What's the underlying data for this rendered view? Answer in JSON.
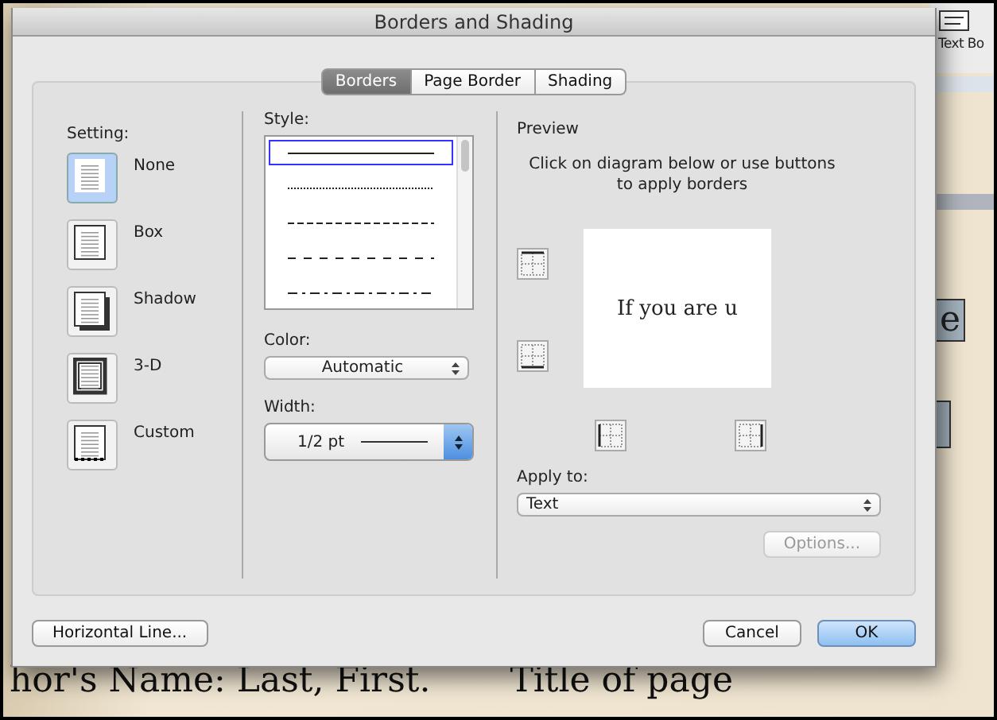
{
  "window": {
    "title": "Borders and Shading"
  },
  "tabs": [
    {
      "label": "Borders",
      "selected": true
    },
    {
      "label": "Page Border",
      "selected": false
    },
    {
      "label": "Shading",
      "selected": false
    }
  ],
  "setting": {
    "label": "Setting:",
    "items": [
      {
        "label": "None",
        "kind": "none",
        "selected": true
      },
      {
        "label": "Box",
        "kind": "box",
        "selected": false
      },
      {
        "label": "Shadow",
        "kind": "shadow",
        "selected": false
      },
      {
        "label": "3-D",
        "kind": "threed",
        "selected": false
      },
      {
        "label": "Custom",
        "kind": "custom",
        "selected": false
      }
    ]
  },
  "style": {
    "label": "Style:",
    "lines": [
      {
        "kind": "solid",
        "selected": true
      },
      {
        "kind": "dotted",
        "selected": false
      },
      {
        "kind": "dashed",
        "selected": false
      },
      {
        "kind": "wide-dashed",
        "selected": false
      },
      {
        "kind": "dash-dot",
        "selected": false
      }
    ]
  },
  "color": {
    "label": "Color:",
    "value": "Automatic"
  },
  "width": {
    "label": "Width:",
    "value": "1/2 pt"
  },
  "preview": {
    "label": "Preview",
    "instruction": "Click on diagram below or use buttons to apply borders",
    "sample_text": "If you are u",
    "border_buttons": [
      {
        "kind": "top"
      },
      {
        "kind": "bottom"
      },
      {
        "kind": "left"
      },
      {
        "kind": "right"
      }
    ]
  },
  "apply_to": {
    "label": "Apply to:",
    "value": "Text"
  },
  "options_button": {
    "label": "Options...",
    "disabled": true
  },
  "horizontal_line_button": {
    "label": "Horizontal Line..."
  },
  "buttons": [
    {
      "label": "Cancel",
      "default": false
    },
    {
      "label": "OK",
      "default": true
    }
  ],
  "background": {
    "toolbar_label": "Text Bo",
    "highlight_letter": "e",
    "document_texts": [
      "hor's Name: Last, First.",
      "Title of page"
    ]
  }
}
